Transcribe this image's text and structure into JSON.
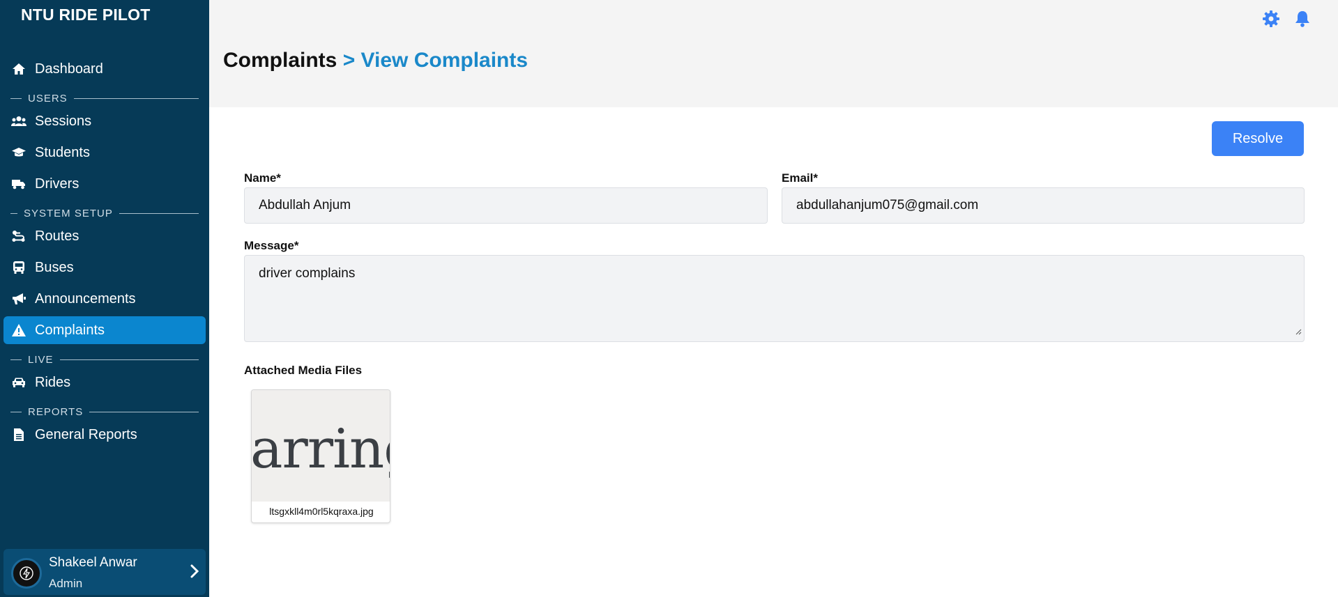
{
  "app": {
    "brand": "NTU RIDE PILOT"
  },
  "sidebar": {
    "items": [
      {
        "label": "Dashboard",
        "icon": "home-icon"
      },
      {
        "section": "USERS"
      },
      {
        "label": "Sessions",
        "icon": "users-icon"
      },
      {
        "label": "Students",
        "icon": "graduation-cap-icon"
      },
      {
        "label": "Drivers",
        "icon": "truck-icon"
      },
      {
        "section": "SYSTEM SETUP"
      },
      {
        "label": "Routes",
        "icon": "route-icon"
      },
      {
        "label": "Buses",
        "icon": "bus-icon"
      },
      {
        "label": "Announcements",
        "icon": "megaphone-icon"
      },
      {
        "label": "Complaints",
        "icon": "warning-icon",
        "active": true
      },
      {
        "section": "LIVE"
      },
      {
        "label": "Rides",
        "icon": "car-icon"
      },
      {
        "section": "REPORTS"
      },
      {
        "label": "General Reports",
        "icon": "file-text-icon"
      }
    ],
    "sections": {
      "users": "USERS",
      "system_setup": "SYSTEM SETUP",
      "live": "LIVE",
      "reports": "REPORTS"
    },
    "labels": {
      "dashboard": "Dashboard",
      "sessions": "Sessions",
      "students": "Students",
      "drivers": "Drivers",
      "routes": "Routes",
      "buses": "Buses",
      "announcements": "Announcements",
      "complaints": "Complaints",
      "rides": "Rides",
      "general_reports": "General Reports"
    },
    "user": {
      "name": "Shakeel Anwar",
      "role": "Admin"
    }
  },
  "header": {
    "breadcrumb_root": "Complaints",
    "breadcrumb_current": "> View Complaints",
    "icons": [
      "gear-icon",
      "bell-icon"
    ]
  },
  "form": {
    "resolve_label": "Resolve",
    "name_label": "Name*",
    "name_value": "Abdullah Anjum",
    "email_label": "Email*",
    "email_value": "abdullahanjum075@gmail.com",
    "message_label": "Message*",
    "message_value": "driver complains",
    "media_label": "Attached Media Files",
    "media": [
      {
        "filename": "ltsgxkll4m0rl5kqraxa.jpg",
        "preview_text": "arring"
      }
    ]
  },
  "colors": {
    "sidebar_bg": "#063a57",
    "active_item": "#0b86cf",
    "accent_blue": "#1a88c9",
    "button_blue": "#3b82f6",
    "header_bg": "#f4f4f4"
  }
}
